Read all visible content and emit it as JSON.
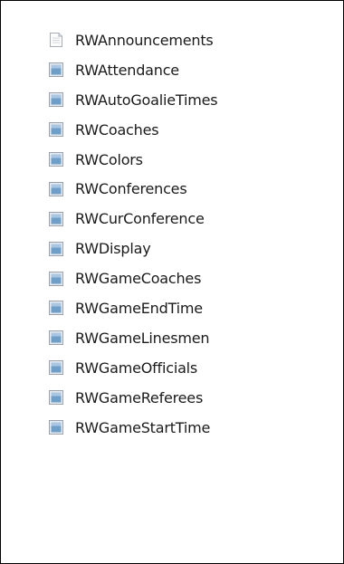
{
  "files": [
    {
      "name": "RWAnnouncements",
      "icon": "blank-document-icon"
    },
    {
      "name": "RWAttendance",
      "icon": "table-file-icon"
    },
    {
      "name": "RWAutoGoalieTimes",
      "icon": "table-file-icon"
    },
    {
      "name": "RWCoaches",
      "icon": "table-file-icon"
    },
    {
      "name": "RWColors",
      "icon": "table-file-icon"
    },
    {
      "name": "RWConferences",
      "icon": "table-file-icon"
    },
    {
      "name": "RWCurConference",
      "icon": "table-file-icon"
    },
    {
      "name": "RWDisplay",
      "icon": "table-file-icon"
    },
    {
      "name": "RWGameCoaches",
      "icon": "table-file-icon"
    },
    {
      "name": "RWGameEndTime",
      "icon": "table-file-icon"
    },
    {
      "name": "RWGameLinesmen",
      "icon": "table-file-icon"
    },
    {
      "name": "RWGameOfficials",
      "icon": "table-file-icon"
    },
    {
      "name": "RWGameReferees",
      "icon": "table-file-icon"
    },
    {
      "name": "RWGameStartTime",
      "icon": "table-file-icon"
    }
  ],
  "colors": {
    "text": "#1a1a1a",
    "border": "#000000",
    "icon_blue": "#6f9fc8",
    "icon_gray": "#c8ccd2"
  }
}
